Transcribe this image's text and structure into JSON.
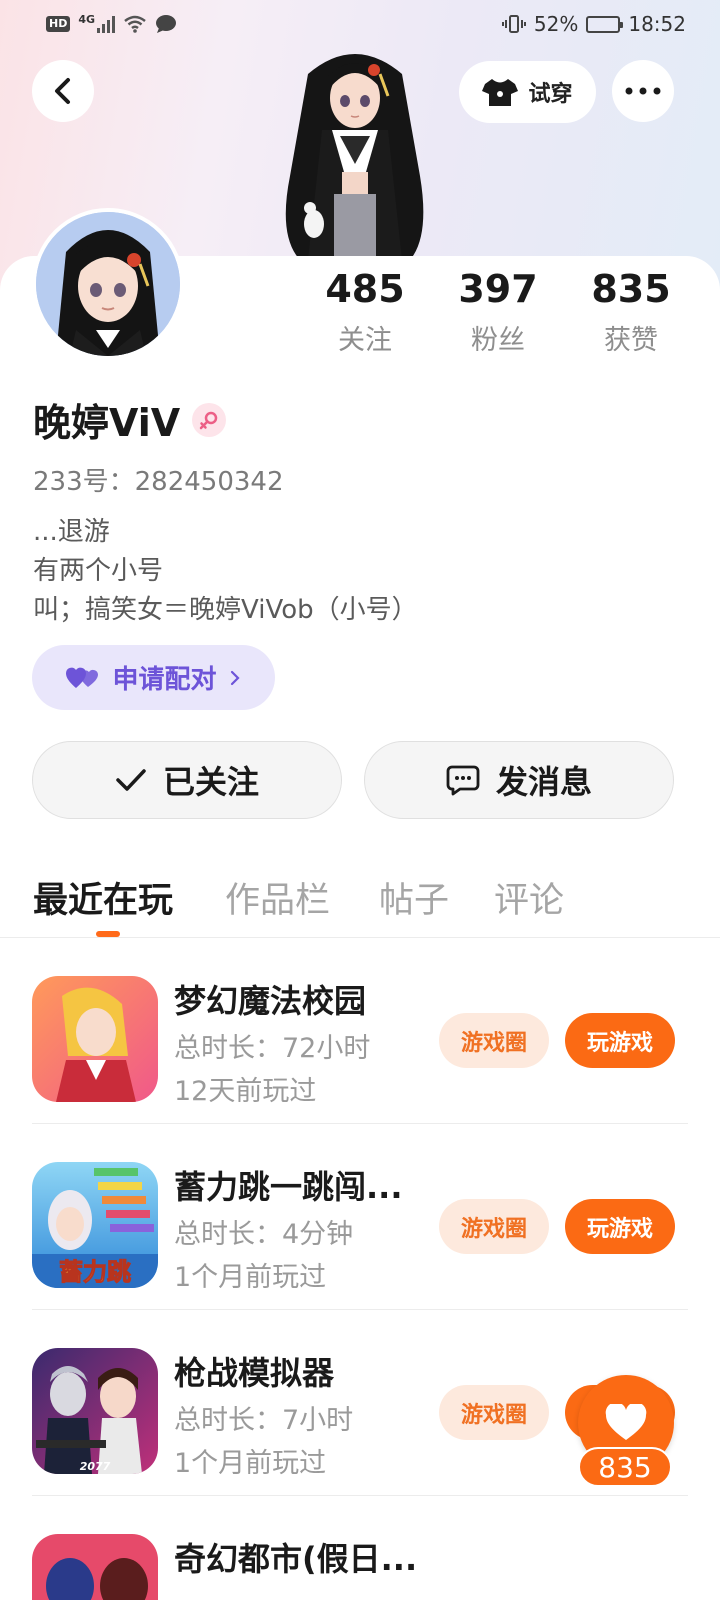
{
  "status_bar": {
    "hd": "HD",
    "network": "4G",
    "battery_percent": "52%",
    "battery_level": 0.52,
    "time": "18:52"
  },
  "header": {
    "try_on_label": "试穿",
    "back_icon": "back-chevron-icon",
    "more_icon": "more-dots-icon"
  },
  "profile": {
    "name": "晚婷ViV",
    "gender_icon": "female-icon",
    "uid_text": "233号：282450342",
    "bio_lines": [
      "...退游",
      "有两个小号",
      "叫；搞笑女＝晚婷ViVob（小号）"
    ],
    "pair_label": "申请配对"
  },
  "stats": [
    {
      "value": "485",
      "label": "关注"
    },
    {
      "value": "397",
      "label": "粉丝"
    },
    {
      "value": "835",
      "label": "获赞"
    }
  ],
  "actions": {
    "followed_label": "已关注",
    "message_label": "发消息"
  },
  "tabs": [
    "最近在玩",
    "作品栏",
    "帖子",
    "评论"
  ],
  "active_tab": "最近在玩",
  "games": [
    {
      "title": "梦幻魔法校园",
      "duration": "总时长：72小时",
      "last_played": "12天前玩过",
      "circle_label": "游戏圈",
      "play_label": "玩游戏"
    },
    {
      "title": "蓄力跳一跳闯...",
      "duration": "总时长：4分钟",
      "last_played": "1个月前玩过",
      "circle_label": "游戏圈",
      "play_label": "玩游戏",
      "icon_text": "蓄力跳"
    },
    {
      "title": "枪战模拟器",
      "duration": "总时长：7小时",
      "last_played": "1个月前玩过",
      "circle_label": "游戏圈",
      "play_label": "玩游戏",
      "icon_text": "2077"
    },
    {
      "title": "奇幻都市(假日..."
    }
  ],
  "like_fab": {
    "count": "835"
  },
  "colors": {
    "accent_orange": "#fb6a14",
    "pair_purple": "#6d54d8",
    "tag_bg": "#fde9dd"
  }
}
